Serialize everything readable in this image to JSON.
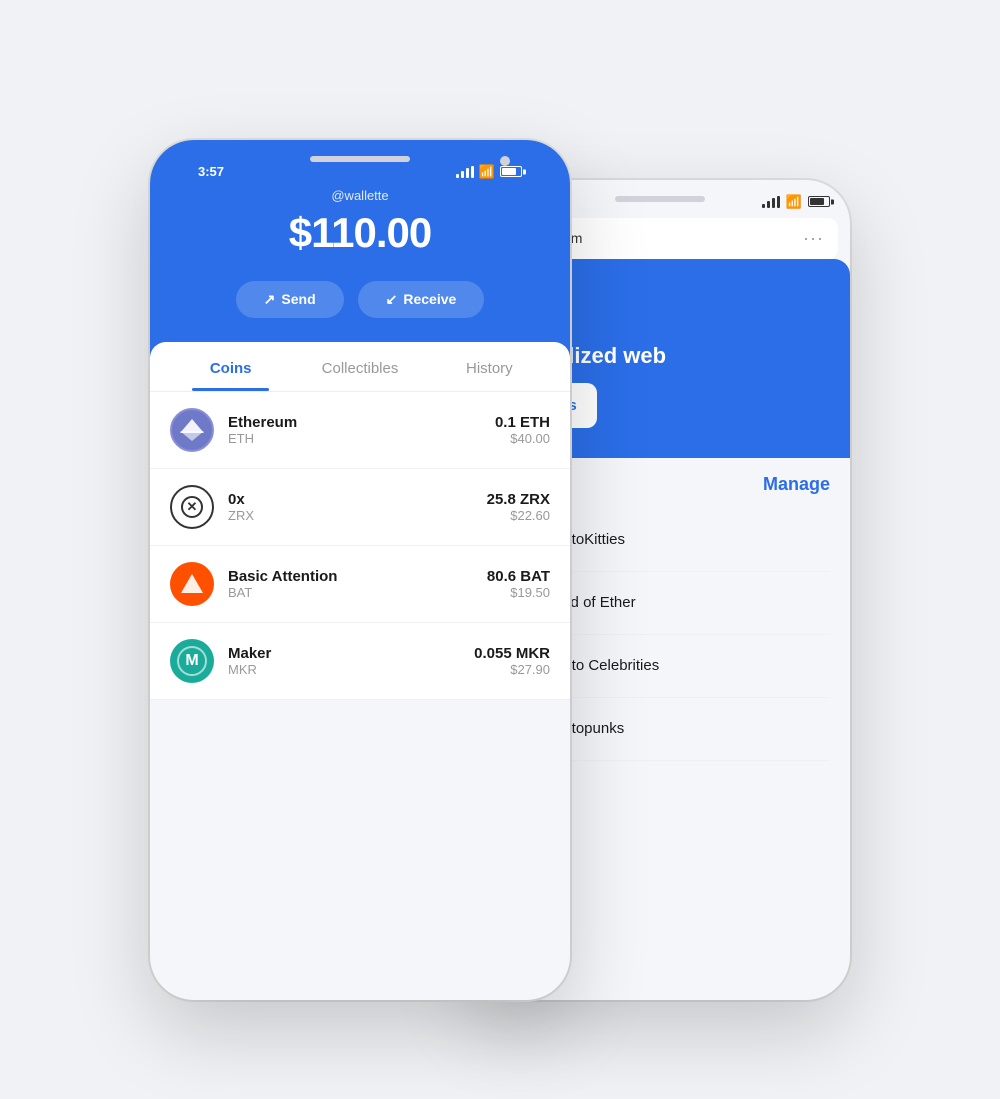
{
  "main_phone": {
    "status_bar": {
      "time": "3:57"
    },
    "header": {
      "username": "@wallette",
      "balance": "$110.00",
      "send_label": "Send",
      "receive_label": "Receive"
    },
    "tabs": [
      {
        "label": "Coins",
        "active": true
      },
      {
        "label": "Collectibles",
        "active": false
      },
      {
        "label": "History",
        "active": false
      }
    ],
    "coins": [
      {
        "name": "Ethereum",
        "symbol": "ETH",
        "amount": "0.1 ETH",
        "usd": "$40.00",
        "icon": "eth"
      },
      {
        "name": "0x",
        "symbol": "ZRX",
        "amount": "25.8 ZRX",
        "usd": "$22.60",
        "icon": "zrx"
      },
      {
        "name": "Basic Attention",
        "symbol": "BAT",
        "amount": "80.6 BAT",
        "usd": "$19.50",
        "icon": "bat"
      },
      {
        "name": "Maker",
        "symbol": "MKR",
        "amount": "0.055 MKR",
        "usd": "$27.90",
        "icon": "mkr"
      }
    ]
  },
  "back_phone": {
    "browser_url": "coinbase.com",
    "browser_dots": "···",
    "hero": {
      "tagline": "ecentralized web",
      "cta_label": "er DApps"
    },
    "manage": {
      "title": "Manage",
      "dapps": [
        {
          "name": "CryptoKitties",
          "icon": "cryptokitties"
        },
        {
          "name": "World of Ether",
          "icon": "worldofether"
        },
        {
          "name": "Crypto Celebrities",
          "icon": "cryptocelebrities"
        },
        {
          "name": "Cryptopunks",
          "icon": "cryptopunks"
        }
      ]
    }
  }
}
